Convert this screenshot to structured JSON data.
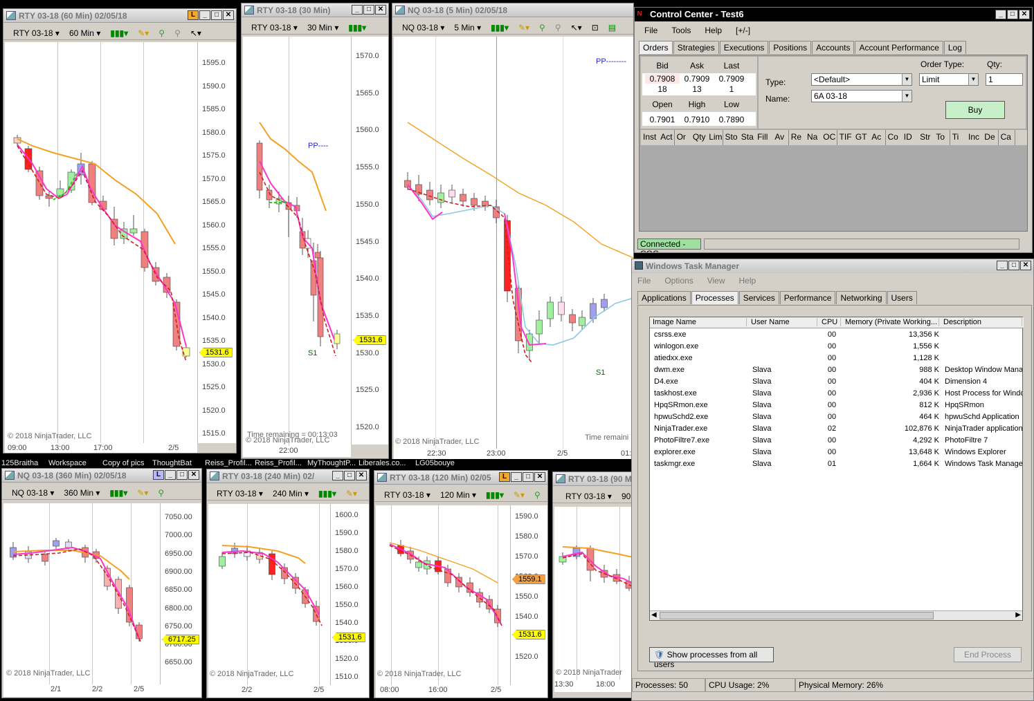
{
  "charts": {
    "rty60": {
      "title": "RTY 03-18 (60 Min)  02/05/18",
      "instrument": "RTY 03-18",
      "interval": "60 Min",
      "ticks": [
        "1595.0",
        "1590.0",
        "1585.0",
        "1580.0",
        "1575.0",
        "1570.0",
        "1565.0",
        "1560.0",
        "1555.0",
        "1550.0",
        "1545.0",
        "1540.0",
        "1535.0",
        "1530.0",
        "1525.0",
        "1520.0",
        "1515.0"
      ],
      "x_labels": [
        "09:00",
        "13:00",
        "17:00",
        "2/5"
      ],
      "last_price": "1531.6",
      "copyright": "© 2018 NinjaTrader, LLC"
    },
    "rty30": {
      "title": "RTY 03-18 (30 Min)",
      "instrument": "RTY 03-18",
      "interval": "30 Min",
      "ticks": [
        "1570.0",
        "1565.0",
        "1560.0",
        "1555.0",
        "1550.0",
        "1545.0",
        "1540.0",
        "1535.0",
        "1530.0",
        "1525.0",
        "1520.0"
      ],
      "x_labels": [
        "22:00"
      ],
      "last_price": "1531.6",
      "pp_label": "PP----",
      "s1_label": "S1",
      "time_remaining": "Time remaining = 00:13:03",
      "copyright": "© 2018 NinjaTrader, LLC"
    },
    "nq5": {
      "title": "NQ 03-18 (5 Min)  02/05/18",
      "instrument": "NQ 03-18",
      "interval": "5 Min",
      "x_labels": [
        "22:30",
        "23:00",
        "2/5",
        "01:"
      ],
      "pp_label": "PP--------",
      "s1_label": "S1",
      "time_remaining": "Time remaini",
      "copyright": "© 2018 NinjaTrader, LLC"
    },
    "nq360": {
      "title": "NQ 03-18 (360 Min)  02/05/18",
      "instrument": "NQ 03-18",
      "interval": "360 Min",
      "ticks": [
        "7050.00",
        "7000.00",
        "6950.00",
        "6900.00",
        "6850.00",
        "6800.00",
        "6750.00",
        "6700.00",
        "6650.00"
      ],
      "x_labels": [
        "2/1",
        "2/2",
        "2/5"
      ],
      "last_price": "6717.25",
      "copyright": "© 2018 NinjaTrader, LLC"
    },
    "rty240": {
      "title": "RTY 03-18 (240 Min)  02/",
      "instrument": "RTY 03-18",
      "interval": "240 Min",
      "ticks": [
        "1600.0",
        "1590.0",
        "1580.0",
        "1570.0",
        "1560.0",
        "1550.0",
        "1540.0",
        "1530.0",
        "1520.0",
        "1510.0"
      ],
      "x_labels": [
        "2/2",
        "2/5"
      ],
      "last_price": "1531.6",
      "copyright": "© 2018 NinjaTrader, LLC"
    },
    "rty120": {
      "title": "RTY 03-18 (120 Min)  02/05",
      "instrument": "RTY 03-18",
      "interval": "120 Min",
      "ticks": [
        "1590.0",
        "1580.0",
        "1570.0",
        "1560.0",
        "1550.0",
        "1540.0",
        "1530.0",
        "1520.0"
      ],
      "x_labels": [
        "08:00",
        "16:00",
        "2/5"
      ],
      "last_price": "1531.6",
      "alt_price": "1559.1",
      "copyright": "© 2018 NinjaTrader, LLC"
    },
    "rty90": {
      "title": "RTY 03-18 (90 M",
      "instrument": "RTY 03-18",
      "interval": "90 M",
      "x_labels": [
        "13:30",
        "18:00"
      ],
      "copyright": "© 2018 NinjaTrader"
    }
  },
  "taskbar_items": [
    "125Braitha",
    "Workspace",
    "Copy of pics",
    "ThoughtBat",
    "Reiss_Profil...",
    "Reiss_Profil...",
    "MyThoughtP...",
    "Liberales.co...",
    "LG05bouye"
  ],
  "control_center": {
    "title": "Control Center - Test6",
    "menu": [
      "File",
      "Tools",
      "Help",
      "[+/-]"
    ],
    "tabs": [
      "Orders",
      "Strategies",
      "Executions",
      "Positions",
      "Accounts",
      "Account Performance",
      "Log"
    ],
    "quote": {
      "headers1": [
        "Bid",
        "Ask",
        "Last"
      ],
      "row1": [
        "0.7908",
        "0.7909",
        "0.7909"
      ],
      "row2": [
        "18",
        "13",
        "1"
      ],
      "headers2": [
        "Open",
        "High",
        "Low"
      ],
      "row3": [
        "0.7901",
        "0.7910",
        "0.7890"
      ]
    },
    "order_type_label": "Order Type:",
    "qty_label": "Qty:",
    "type_label": "Type:",
    "type_value": "<Default>",
    "order_type_value": "Limit",
    "qty_value": "1",
    "name_label": "Name:",
    "name_value": "6A 03-18",
    "buy_label": "Buy",
    "grid_columns": [
      "Inst",
      "Act",
      "Or",
      "Qty",
      "Lim",
      "Sto",
      "Sta",
      "Fill",
      "Av",
      "Re",
      "Na",
      "OC",
      "TIF",
      "GT",
      "Ac",
      "Co",
      "ID",
      "Str",
      "To",
      "Ti",
      "Inc",
      "De",
      "Ca"
    ],
    "status": "Connected - CQG"
  },
  "task_manager": {
    "title": "Windows Task Manager",
    "menu": [
      "File",
      "Options",
      "View",
      "Help"
    ],
    "tabs": [
      "Applications",
      "Processes",
      "Services",
      "Performance",
      "Networking",
      "Users"
    ],
    "columns": [
      "Image Name",
      "User Name",
      "CPU",
      "Memory (Private Working...",
      "Description"
    ],
    "processes": [
      {
        "name": "csrss.exe",
        "user": "",
        "cpu": "00",
        "mem": "13,356 K",
        "desc": ""
      },
      {
        "name": "winlogon.exe",
        "user": "",
        "cpu": "00",
        "mem": "1,556 K",
        "desc": ""
      },
      {
        "name": "atiedxx.exe",
        "user": "",
        "cpu": "00",
        "mem": "1,128 K",
        "desc": ""
      },
      {
        "name": "dwm.exe",
        "user": "Slava",
        "cpu": "00",
        "mem": "988 K",
        "desc": "Desktop Window Mana"
      },
      {
        "name": "D4.exe",
        "user": "Slava",
        "cpu": "00",
        "mem": "404 K",
        "desc": "Dimension 4"
      },
      {
        "name": "taskhost.exe",
        "user": "Slava",
        "cpu": "00",
        "mem": "2,936 K",
        "desc": "Host Process for Windo"
      },
      {
        "name": "HpqSRmon.exe",
        "user": "Slava",
        "cpu": "00",
        "mem": "812 K",
        "desc": "HpqSRmon"
      },
      {
        "name": "hpwuSchd2.exe",
        "user": "Slava",
        "cpu": "00",
        "mem": "464 K",
        "desc": "hpwuSchd Application"
      },
      {
        "name": "NinjaTrader.exe",
        "user": "Slava",
        "cpu": "02",
        "mem": "102,876 K",
        "desc": "NinjaTrader application"
      },
      {
        "name": "PhotoFiltre7.exe",
        "user": "Slava",
        "cpu": "00",
        "mem": "4,292 K",
        "desc": "PhotoFiltre 7"
      },
      {
        "name": "explorer.exe",
        "user": "Slava",
        "cpu": "00",
        "mem": "13,648 K",
        "desc": "Windows Explorer"
      },
      {
        "name": "taskmgr.exe",
        "user": "Slava",
        "cpu": "01",
        "mem": "1,664 K",
        "desc": "Windows Task Manage"
      }
    ],
    "show_all_label": "Show processes from all users",
    "end_process_label": "End Process",
    "status": {
      "processes": "Processes: 50",
      "cpu": "CPU Usage: 2%",
      "memory": "Physical Memory: 26%"
    }
  },
  "colors": {
    "up": "#90ee90",
    "down": "#e8302c",
    "ema": "#f5a020",
    "magenta": "#ff33cc",
    "stop": "#cc2020",
    "cyan": "#8fc8e0",
    "last": "#ffff00"
  }
}
